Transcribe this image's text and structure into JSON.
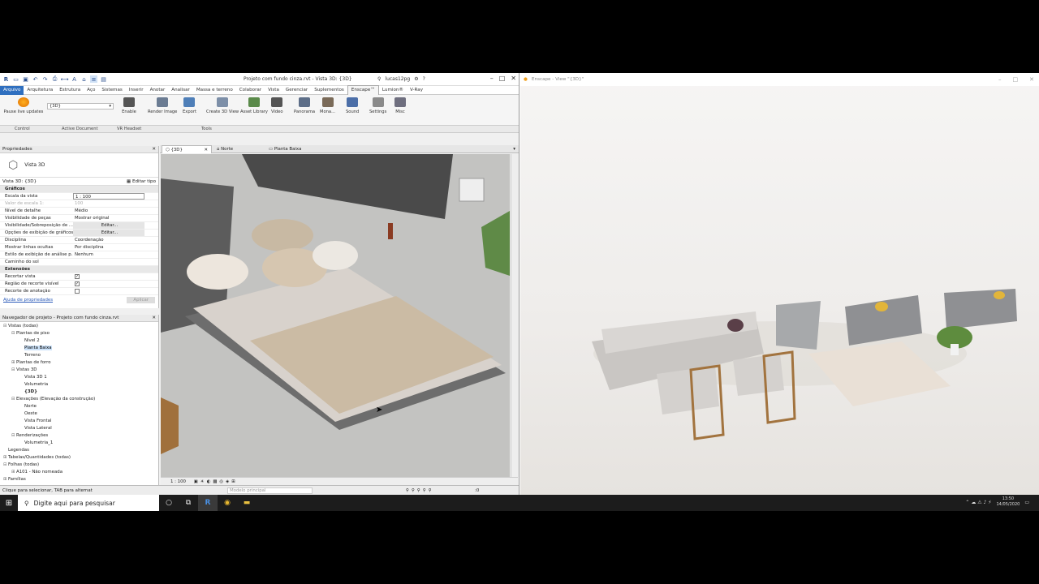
{
  "revit": {
    "title": "Projeto com fundo cinza.rvt - Vista 3D: {3D}",
    "user": "lucas12pg",
    "tabs": [
      "Arquivo",
      "Arquitetura",
      "Estrutura",
      "Aço",
      "Sistemas",
      "Inserir",
      "Anotar",
      "Analisar",
      "Massa e terreno",
      "Colaborar",
      "Vista",
      "Gerenciar",
      "Suplementos",
      "Enscape™",
      "Lumion®",
      "V-Ray"
    ],
    "ribbon": {
      "pause_label": "Pause live updates",
      "view_value": "{3D}",
      "enable": "Enable",
      "tools": [
        "Render Image",
        "Export",
        "Create 3D View",
        "Asset Library",
        "Video",
        "Panorama",
        "Mona...",
        "Sound",
        "Settings",
        "Misc"
      ]
    },
    "panels": [
      "Control",
      "Active Document",
      "VR Headset",
      "Tools"
    ],
    "properties": {
      "header": "Propriedades",
      "type_name": "Vista 3D",
      "view_selector": "Vista 3D: {3D}",
      "edit_type": "Editar tipo",
      "group_graphics": "Gráficos",
      "rows": [
        {
          "k": "Escala da vista",
          "v": "1 : 100"
        },
        {
          "k": "Valor de escala    1:",
          "v": "100"
        },
        {
          "k": "Nível de detalhe",
          "v": "Médio"
        },
        {
          "k": "Visibilidade de peças",
          "v": "Mostrar original"
        },
        {
          "k": "Visibilidade/Sobreposição de ...",
          "v": "Editar..."
        },
        {
          "k": "Opções de exibição de gráficos",
          "v": "Editar..."
        },
        {
          "k": "Disciplina",
          "v": "Coordenação"
        },
        {
          "k": "Mostrar linhas ocultas",
          "v": "Por disciplina"
        },
        {
          "k": "Estilo de exibição de análise p...",
          "v": "Nenhum"
        },
        {
          "k": "Caminho do sol",
          "v": ""
        }
      ],
      "group_extents": "Extensões",
      "extents": [
        "Recortar vista",
        "Região de recorte visível",
        "Recorte de anotação"
      ],
      "help": "Ajuda de propriedades",
      "apply": "Aplicar"
    },
    "browser": {
      "header": "Navegador de projeto - Projeto com fundo cinza.rvt",
      "items": [
        {
          "t": "Vistas (todas)",
          "d": 0,
          "g": "⊟"
        },
        {
          "t": "Plantas de piso",
          "d": 1,
          "g": "⊟"
        },
        {
          "t": "Nível 2",
          "d": 2,
          "g": ""
        },
        {
          "t": "Planta Baixa",
          "d": 2,
          "g": "",
          "sel": true
        },
        {
          "t": "Terreno",
          "d": 2,
          "g": ""
        },
        {
          "t": "Plantas de forro",
          "d": 1,
          "g": "⊞"
        },
        {
          "t": "Vistas 3D",
          "d": 1,
          "g": "⊟"
        },
        {
          "t": "Vista 3D 1",
          "d": 2,
          "g": ""
        },
        {
          "t": "Volumetria",
          "d": 2,
          "g": ""
        },
        {
          "t": "{3D}",
          "d": 2,
          "g": "",
          "bold": true
        },
        {
          "t": "Elevações (Elevação da construção)",
          "d": 1,
          "g": "⊟"
        },
        {
          "t": "Norte",
          "d": 2,
          "g": ""
        },
        {
          "t": "Oeste",
          "d": 2,
          "g": ""
        },
        {
          "t": "Vista Frontal",
          "d": 2,
          "g": ""
        },
        {
          "t": "Vista Lateral",
          "d": 2,
          "g": ""
        },
        {
          "t": "Renderizações",
          "d": 1,
          "g": "⊟"
        },
        {
          "t": "Volumetria_1",
          "d": 2,
          "g": ""
        },
        {
          "t": "Legendas",
          "d": 0,
          "g": ""
        },
        {
          "t": "Tabelas/Quantidades (todas)",
          "d": 0,
          "g": "⊞"
        },
        {
          "t": "Folhas (todas)",
          "d": 0,
          "g": "⊟"
        },
        {
          "t": "A101 - Não nomeada",
          "d": 1,
          "g": "⊞"
        },
        {
          "t": "Famílias",
          "d": 0,
          "g": "⊞"
        }
      ]
    },
    "view_tabs": [
      "{3D}",
      "Norte",
      "Planta Baixa"
    ],
    "view_scale": "1 : 100",
    "status": "Clique para selecionar, TAB para alternat",
    "model": "Modelo principal",
    "status_num": ":0"
  },
  "enscape": {
    "title": "Enscape - View \"{3D}\""
  },
  "taskbar": {
    "search_placeholder": "Digite aqui para pesquisar",
    "time": "13:50",
    "date": "14/05/2020"
  }
}
